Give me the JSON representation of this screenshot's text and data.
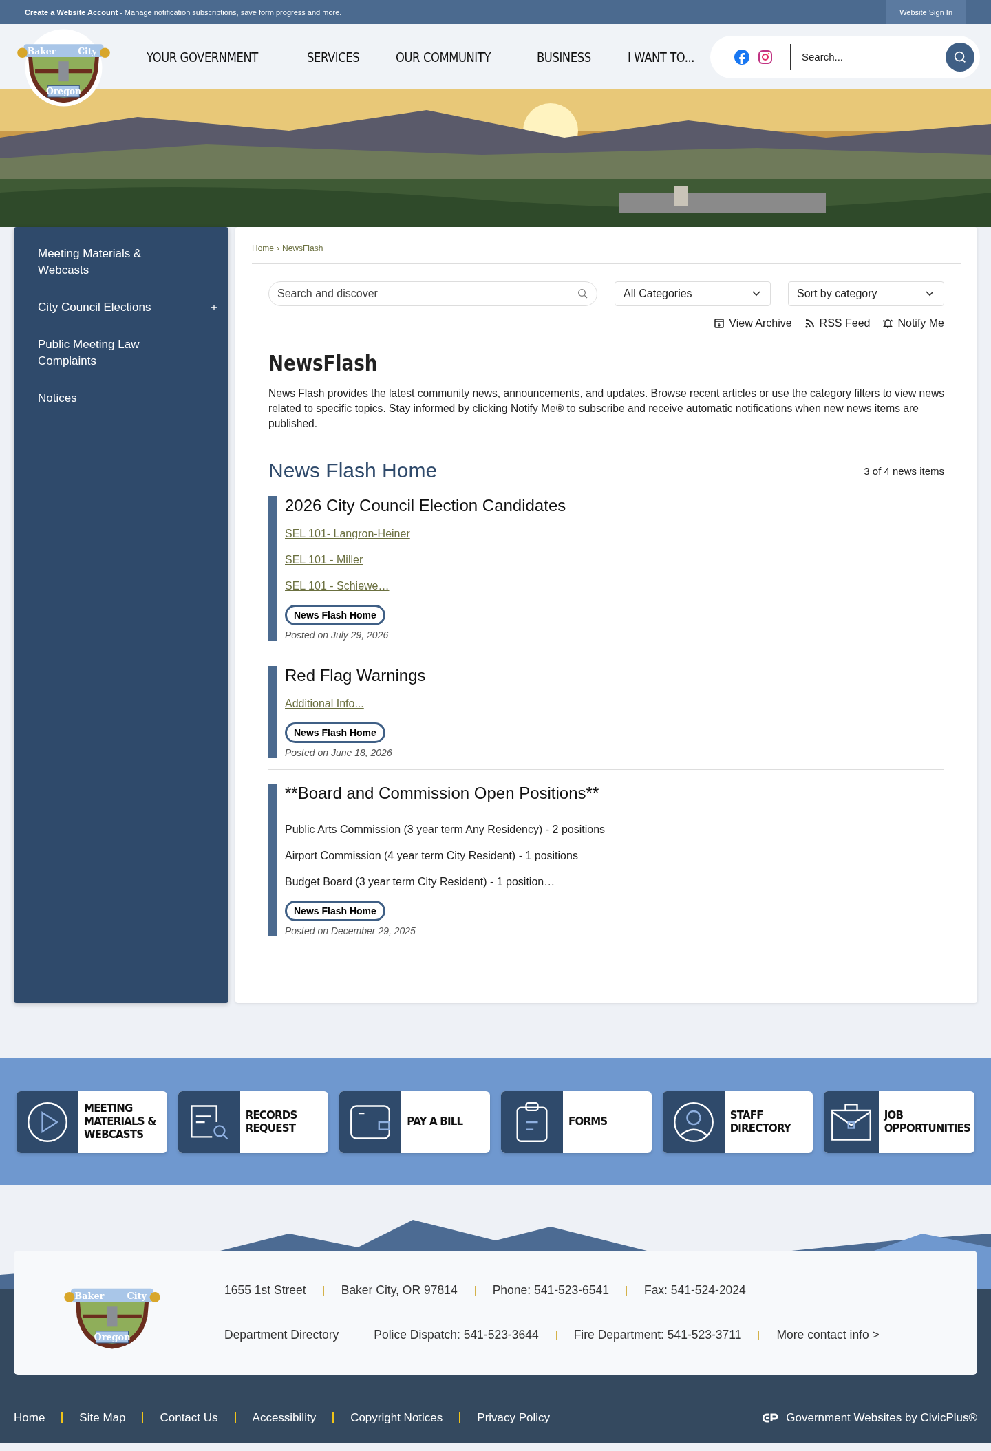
{
  "top_bar": {
    "account_link": "Create a Website Account",
    "account_text": " - Manage notification subscriptions, save form progress and more.",
    "sign_in": "Website Sign In"
  },
  "header": {
    "logo": {
      "top_left": "Baker",
      "top_right": "City",
      "bottom": "Oregon"
    },
    "nav": [
      "YOUR GOVERNMENT",
      "SERVICES",
      "OUR COMMUNITY",
      "BUSINESS",
      "I WANT TO..."
    ],
    "search": {
      "placeholder": "Search..."
    }
  },
  "sidebar": {
    "items": [
      {
        "label": "Meeting Materials & Webcasts",
        "expandable": false
      },
      {
        "label": "City Council Elections",
        "expandable": true
      },
      {
        "label": "Public Meeting Law Complaints",
        "expandable": false
      },
      {
        "label": "Notices",
        "expandable": false
      }
    ]
  },
  "breadcrumb": {
    "home": "Home",
    "separator": "›",
    "current": "NewsFlash"
  },
  "filters": {
    "search_placeholder": "Search and discover",
    "category": "All Categories",
    "sort": "Sort by category"
  },
  "actions": [
    {
      "label": "View Archive",
      "kind": "archive"
    },
    {
      "label": "RSS Feed",
      "kind": "rss"
    },
    {
      "label": "Notify Me",
      "kind": "bell"
    }
  ],
  "page_title": "NewsFlash",
  "intro": "News Flash provides the latest community news, announcements, and updates. Browse recent articles or use the category filters to view news related to specific topics. Stay informed by clicking Notify Me® to subscribe and receive automatic notifications when new news items are published.",
  "section": {
    "title": "News Flash Home",
    "count": "3 of 4 news items"
  },
  "news": [
    {
      "title": "2026 City Council Election Candidates",
      "lines": [
        {
          "kind": "link",
          "text": "SEL 101- Langron-Heiner"
        },
        {
          "kind": "link",
          "text": "SEL 101 - Miller"
        },
        {
          "kind": "link",
          "text": "SEL 101 - Schiewe…"
        }
      ],
      "tag": "News Flash Home",
      "posted": "Posted on July 29, 2026"
    },
    {
      "title": "Red Flag Warnings",
      "lines": [
        {
          "kind": "link",
          "text": "Additional Info..."
        }
      ],
      "tag": "News Flash Home",
      "posted": "Posted on June 18, 2026"
    },
    {
      "title": "**Board and Commission Open Positions**",
      "lines": [
        {
          "kind": "text",
          "text": "Public Arts Commission (3 year term Any Residency) - 2 positions"
        },
        {
          "kind": "text",
          "text": "Airport Commission (4 year term City Resident) - 1 positions"
        },
        {
          "kind": "text",
          "text": "Budget Board (3 year term City Resident) - 1 position…"
        }
      ],
      "tag": "News Flash Home",
      "posted": "Posted on December 29, 2025"
    }
  ],
  "quick_links": [
    {
      "label": "MEETING MATERIALS & WEBCASTS",
      "kind": "play"
    },
    {
      "label": "RECORDS REQUEST",
      "kind": "records"
    },
    {
      "label": "PAY A BILL",
      "kind": "wallet"
    },
    {
      "label": "FORMS",
      "kind": "clipboard"
    },
    {
      "label": "STAFF DIRECTORY",
      "kind": "person"
    },
    {
      "label": "JOB OPPORTUNITIES",
      "kind": "briefcase"
    }
  ],
  "footer": {
    "logo": {
      "top_left": "Baker",
      "top_right": "City",
      "bottom": "Oregon"
    },
    "contact_rows": [
      [
        "1655 1st Street",
        "Baker City, OR 97814",
        "Phone: 541-523-6541",
        "Fax: 541-524-2024"
      ],
      [
        "Department Directory",
        "Police Dispatch: 541-523-3644",
        "Fire Department: 541-523-3711",
        "More contact info >"
      ]
    ],
    "links": [
      "Home",
      "Site Map",
      "Contact Us",
      "Accessibility",
      "Copyright Notices",
      "Privacy Policy"
    ],
    "credit": "Government Websites by CivicPlus®"
  }
}
